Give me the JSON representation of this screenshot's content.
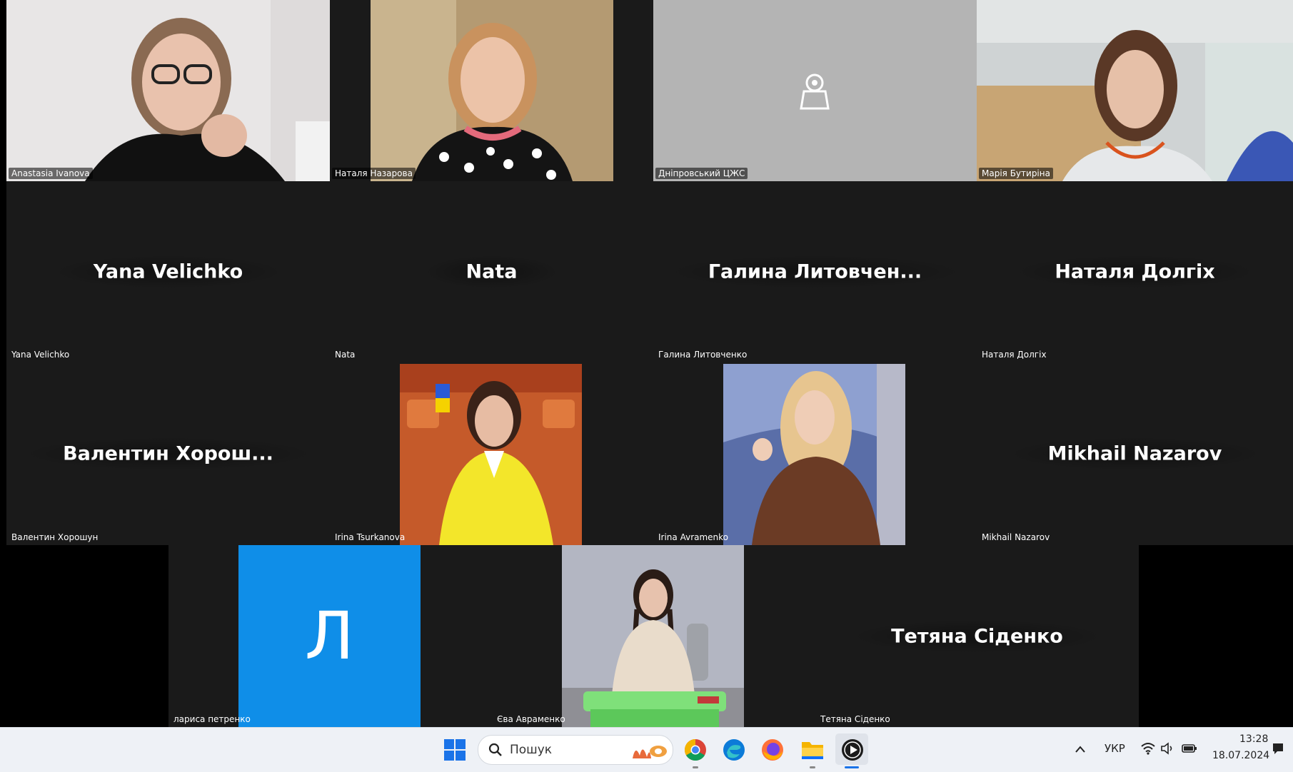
{
  "participants": {
    "anastasia": {
      "tag": "Anastasia Ivanova"
    },
    "natalia_naz": {
      "tag": "Наталя Назарова"
    },
    "dnipro": {
      "tag": "Дніпровський ЦЖС"
    },
    "maria": {
      "tag": "Марія Бутиріна"
    },
    "yana": {
      "display": "Yana Velichko",
      "tag": "Yana Velichko"
    },
    "nata": {
      "display": "Nata",
      "tag": "Nata"
    },
    "halyna": {
      "display": "Галина  Литовчен...",
      "tag": "Галина Литовченко"
    },
    "natalia_dol": {
      "display": "Наталя Долгіх",
      "tag": "Наталя Долгіх"
    },
    "valentyn": {
      "display": "Валентин  Хорош...",
      "tag": "Валентин Хорошун"
    },
    "irina_ts": {
      "tag": "Irina Tsurkanova"
    },
    "irina_av": {
      "tag": "Irina Avramenko"
    },
    "mikhail": {
      "display": "Mikhail Nazarov",
      "tag": "Mikhail Nazarov"
    },
    "larysa": {
      "avatar_letter": "Л",
      "tag": "лариса петренко"
    },
    "eva": {
      "tag": "Єва Авраменко"
    },
    "tetiana": {
      "display": "Тетяна Сіденко",
      "tag": "Тетяна Сіденко"
    }
  },
  "taskbar": {
    "search_placeholder": "Пошук",
    "language": "УКР",
    "time": "13:28",
    "date": "18.07.2024"
  },
  "colors": {
    "avatar_blue": "#0f8ee8",
    "tile_dark": "#1a1a1a",
    "taskbar_bg": "#eef1f6"
  }
}
